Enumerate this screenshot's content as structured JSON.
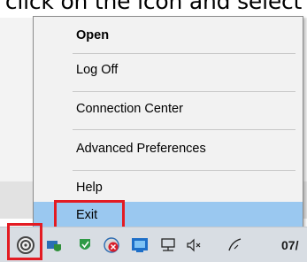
{
  "caption": "click on the icon and select",
  "menu": {
    "items": [
      {
        "label": "Open",
        "bold": true
      },
      {
        "label": "Log Off"
      },
      {
        "label": "Connection Center"
      },
      {
        "label": "Advanced Preferences"
      },
      {
        "label": "Help"
      },
      {
        "label": "Exit",
        "highlighted": true
      }
    ]
  },
  "taskbar": {
    "clock_text": "07/",
    "icons": [
      "citrix-receiver-icon",
      "network-shield-icon",
      "security-shield-icon",
      "stop-error-icon",
      "monitor-app-icon",
      "network-icon",
      "speaker-muted-icon",
      "pen-tablet-icon"
    ]
  },
  "colors": {
    "highlight": "#9ac8f0",
    "annotation": "#e31b23"
  }
}
